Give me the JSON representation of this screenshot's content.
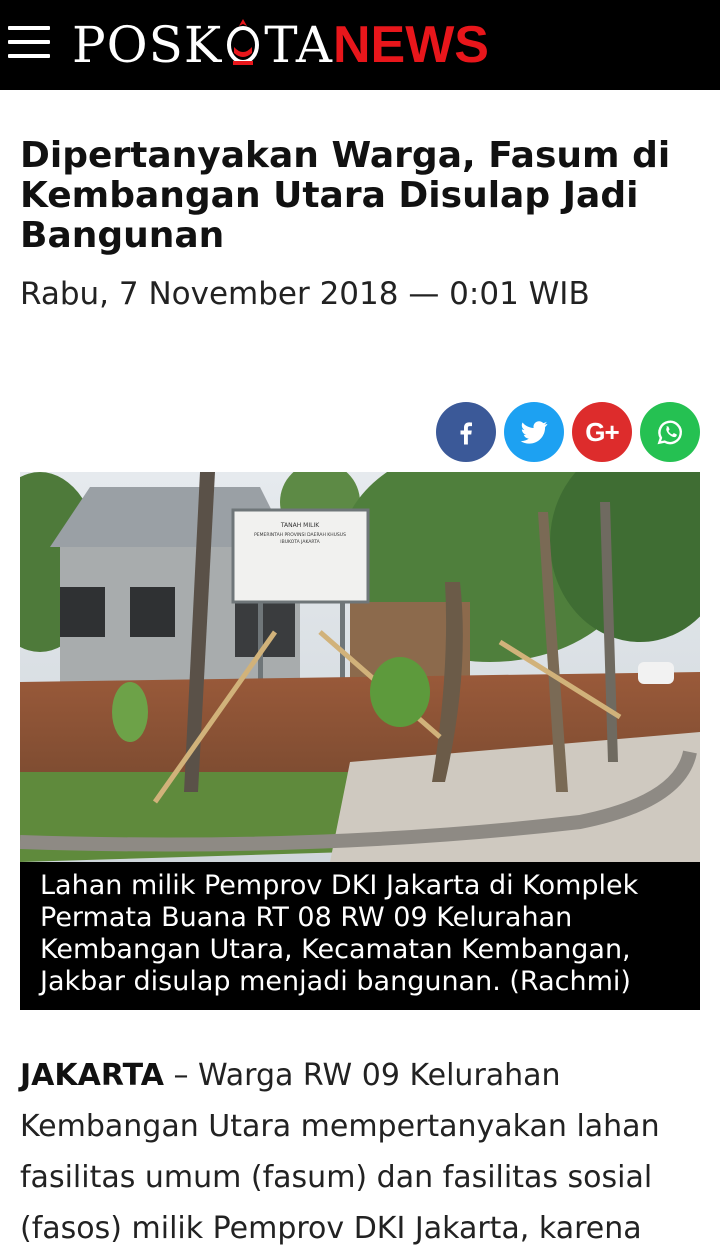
{
  "header": {
    "logo_main": "POSK",
    "logo_mid": "TA",
    "logo_news": "NEWS"
  },
  "article": {
    "title": "Dipertanyakan Warga, Fasum di Kembangan Utara Disulap Jadi Bangunan",
    "date": "Rabu, 7 November 2018 — 0:01 WIB",
    "caption": "Lahan milik Pemprov DKI Jakarta di Komplek Permata Buana RT 08 RW 09 Kelurahan Kembangan Utara, Kecamatan Kembangan, Jakbar disulap menjadi bangunan. (Rachmi)",
    "body_lead": "JAKARTA",
    "body_text": " – Warga RW 09 Kelurahan Kembangan Utara mempertanyakan lahan fasilitas umum (fasum) dan fasilitas sosial (fasos) milik Pemprov DKI Jakarta, karena"
  },
  "photo_sign": {
    "line1": "TANAH MILIK",
    "line2": "PEMERINTAH PROVINSI DAERAH KHUSUS",
    "line3": "IBUKOTA JAKARTA"
  },
  "share": [
    {
      "name": "facebook-share-button",
      "icon": "facebook-icon",
      "glyph": "f",
      "color": "#3b5998"
    },
    {
      "name": "twitter-share-button",
      "icon": "twitter-icon",
      "glyph": "",
      "color": "#1da1f2"
    },
    {
      "name": "googleplus-share-button",
      "icon": "google-plus-icon",
      "glyph": "G+",
      "color": "#dd2c2c"
    },
    {
      "name": "whatsapp-share-button",
      "icon": "whatsapp-icon",
      "glyph": "",
      "color": "#25c152"
    }
  ],
  "colors": {
    "header_bg": "#000000",
    "brand_red": "#e8161b",
    "caption_bg": "#000000"
  }
}
